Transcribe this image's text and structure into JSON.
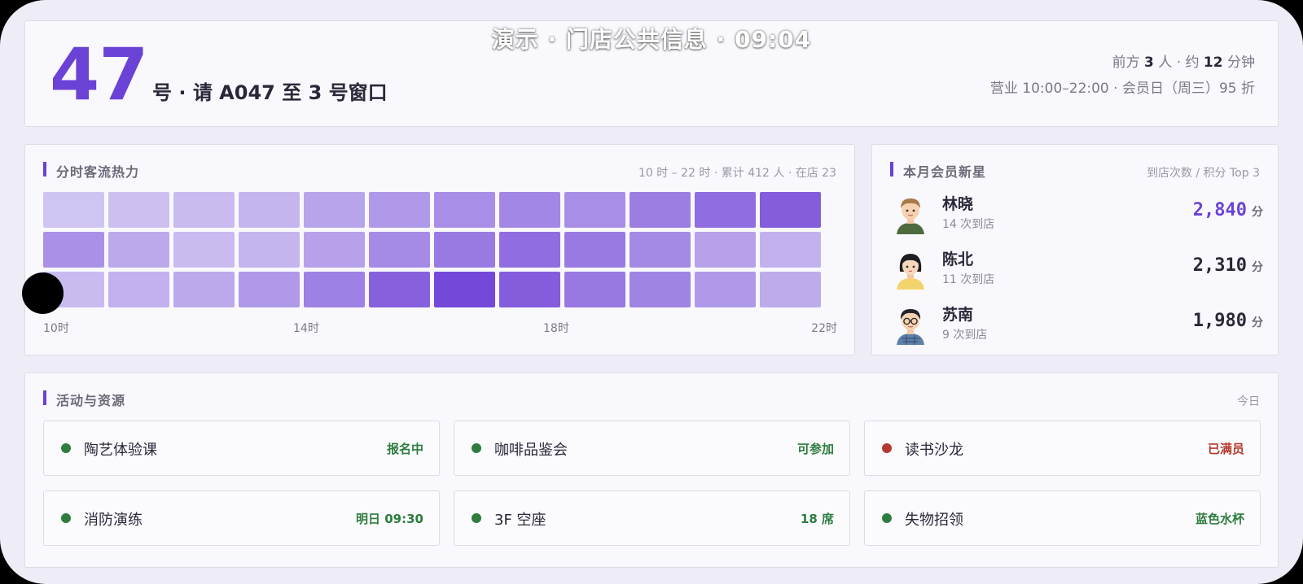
{
  "overlay_title": "演示 · 门店公共信息 · 09:04",
  "call": {
    "number": "47",
    "text": "号 · 请 A047 至 3 号窗口",
    "queue_prefix": "前方 ",
    "queue_people": "3",
    "queue_mid": " 人 · 约 ",
    "queue_minutes": "12",
    "queue_suffix": " 分钟",
    "hours": "营业 10:00–22:00 · 会员日（周三）95 折"
  },
  "heatmap": {
    "title": "分时客流热力",
    "meta": "10 时 – 22 时 · 累计 412 人 · 在店 23",
    "accent": "#6b42d6",
    "chart_data": {
      "type": "heatmap",
      "rows": 3,
      "cols": 12,
      "intensity": [
        [
          0.18,
          0.21,
          0.24,
          0.28,
          0.38,
          0.45,
          0.52,
          0.56,
          0.52,
          0.62,
          0.72,
          0.82
        ],
        [
          0.5,
          0.35,
          0.24,
          0.28,
          0.4,
          0.54,
          0.64,
          0.72,
          0.64,
          0.55,
          0.4,
          0.3
        ],
        [
          0.24,
          0.3,
          0.35,
          0.45,
          0.6,
          0.8,
          0.95,
          0.82,
          0.65,
          0.58,
          0.45,
          0.34
        ]
      ],
      "x_ticks": [
        "10时",
        "14时",
        "18时",
        "22时"
      ]
    }
  },
  "members": {
    "title": "本月会员新星",
    "meta": "到店次数 / 积分 Top 3",
    "unit": "分",
    "list": [
      {
        "name": "林晓",
        "visits": "14 次到店",
        "score": "2,840",
        "avatar": "boy-avatar-icon",
        "highlight": true
      },
      {
        "name": "陈北",
        "visits": "11 次到店",
        "score": "2,310",
        "avatar": "girl-avatar-icon",
        "highlight": false
      },
      {
        "name": "苏南",
        "visits": "9 次到店",
        "score": "1,980",
        "avatar": "glasses-boy-avatar-icon",
        "highlight": false
      }
    ]
  },
  "activities": {
    "title": "活动与资源",
    "meta": "今日",
    "colors": {
      "ok": "#2e7d3e",
      "full": "#b3392e"
    },
    "items": [
      {
        "name": "陶艺体验课",
        "status": "报名中",
        "state": "ok"
      },
      {
        "name": "咖啡品鉴会",
        "status": "可参加",
        "state": "ok"
      },
      {
        "name": "读书沙龙",
        "status": "已满员",
        "state": "full"
      },
      {
        "name": "消防演练",
        "status": "明日 09:30",
        "state": "ok"
      },
      {
        "name": "3F 空座",
        "status": "18 席",
        "state": "ok"
      },
      {
        "name": "失物招领",
        "status": "蓝色水杯",
        "state": "ok"
      }
    ]
  }
}
